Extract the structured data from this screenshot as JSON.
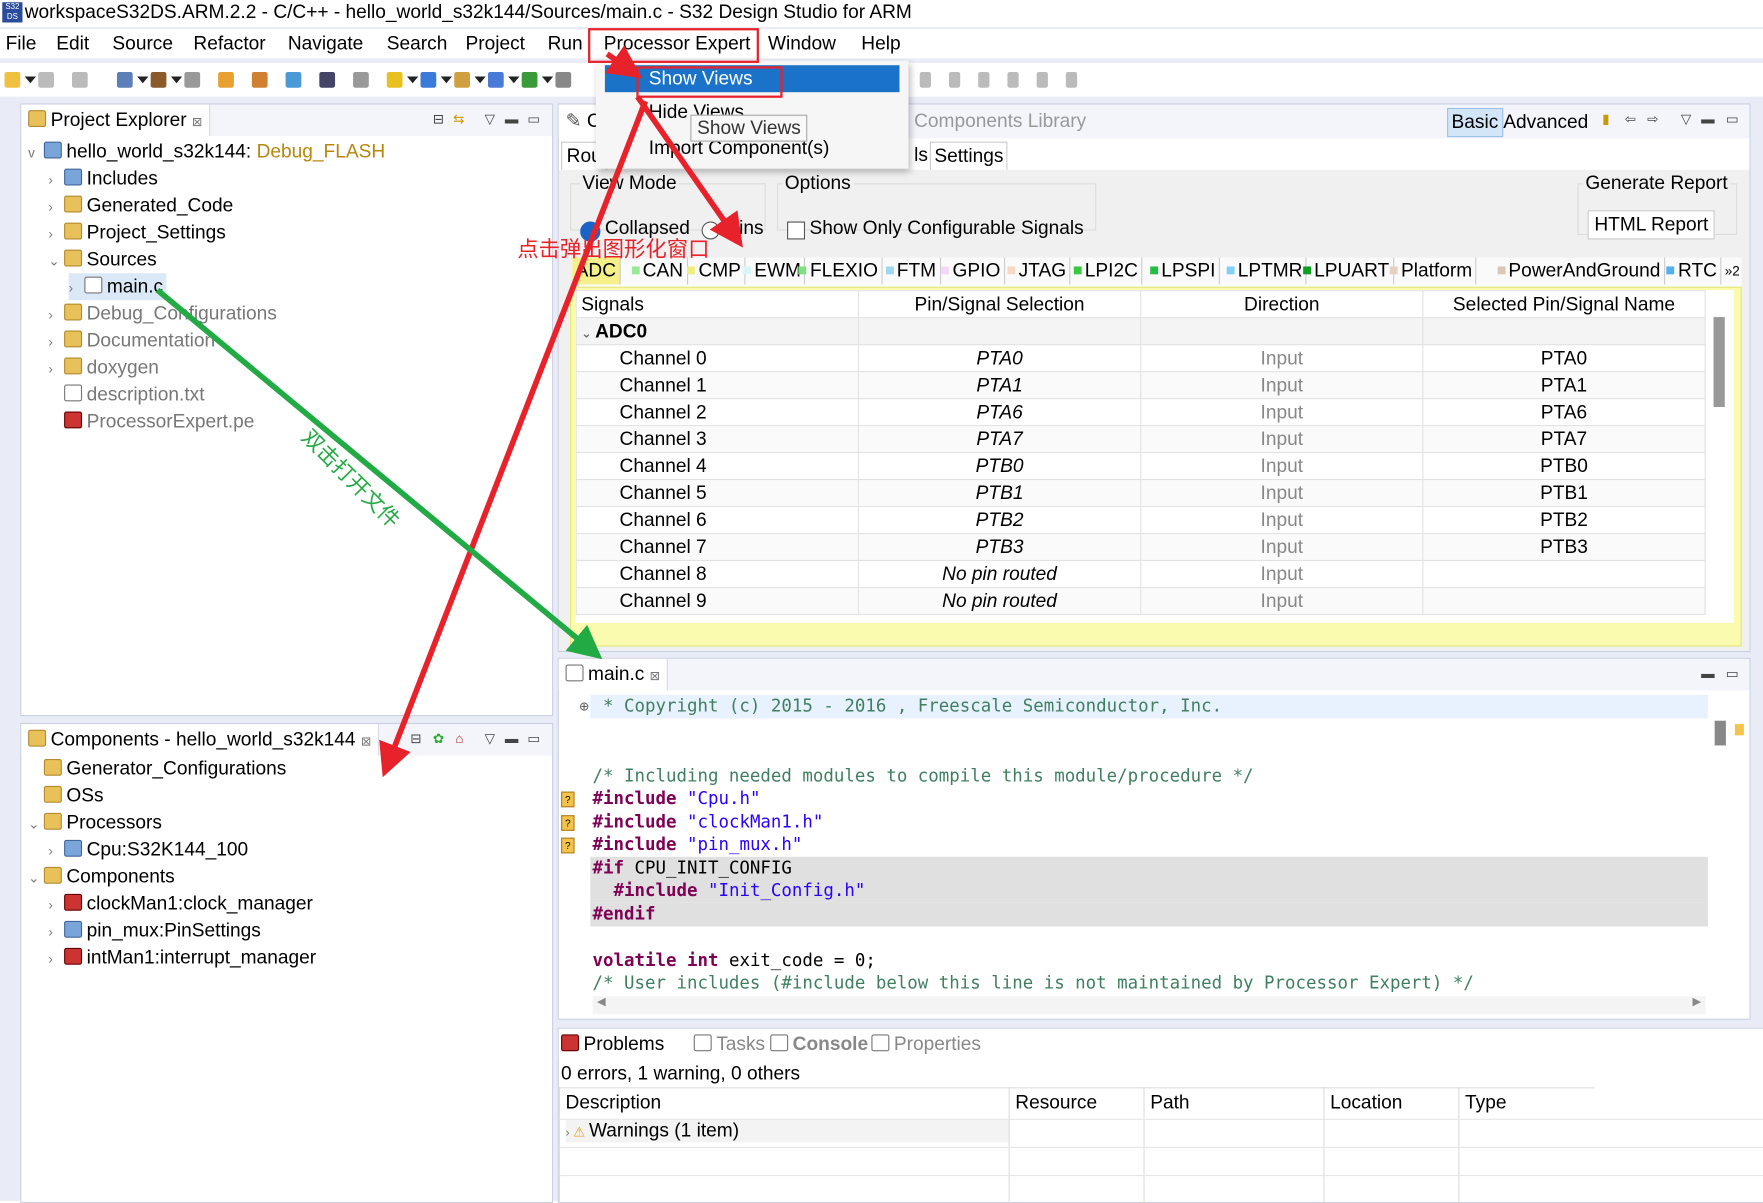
{
  "window": {
    "title": "workspaceS32DS.ARM.2.2 - C/C++ - hello_world_s32k144/Sources/main.c - S32 Design Studio for ARM",
    "logo": "S32 DS"
  },
  "menu": [
    "File",
    "Edit",
    "Source",
    "Refactor",
    "Navigate",
    "Search",
    "Project",
    "Run",
    "Processor Expert",
    "Window",
    "Help"
  ],
  "dropdown": {
    "items": [
      "Show Views",
      "Hide Views",
      "Import Component(s)"
    ],
    "tooltip": "Show Views"
  },
  "project_explorer": {
    "title": "Project Explorer",
    "project": {
      "name": "hello_world_s32k144",
      "config": "Debug_FLASH"
    },
    "items": [
      {
        "label": "Includes",
        "level": 1,
        "icon": "includes",
        "arrow": ">"
      },
      {
        "label": "Generated_Code",
        "level": 1,
        "icon": "folder",
        "arrow": ">"
      },
      {
        "label": "Project_Settings",
        "level": 1,
        "icon": "folder",
        "arrow": ">"
      },
      {
        "label": "Sources",
        "level": 1,
        "icon": "folder",
        "arrow": "v"
      },
      {
        "label": "main.c",
        "level": 2,
        "icon": "file",
        "arrow": ">",
        "selected": true
      },
      {
        "label": "Debug_Configurations",
        "level": 1,
        "icon": "folder",
        "arrow": ">",
        "dim": true
      },
      {
        "label": "Documentation",
        "level": 1,
        "icon": "folder",
        "arrow": ">",
        "dim": true
      },
      {
        "label": "doxygen",
        "level": 1,
        "icon": "folder",
        "arrow": ">",
        "dim": true
      },
      {
        "label": "description.txt",
        "level": 1,
        "icon": "file",
        "arrow": "",
        "dim": true
      },
      {
        "label": "ProcessorExpert.pe",
        "level": 1,
        "icon": "pe",
        "arrow": "",
        "dim": true
      }
    ]
  },
  "components": {
    "title": "Components - hello_world_s32k144",
    "items": [
      {
        "label": "Generator_Configurations",
        "level": 0,
        "icon": "folder",
        "arrow": ""
      },
      {
        "label": "OSs",
        "level": 0,
        "icon": "folder",
        "arrow": ""
      },
      {
        "label": "Processors",
        "level": 0,
        "icon": "folder",
        "arrow": "v"
      },
      {
        "label": "Cpu:S32K144_100",
        "level": 1,
        "icon": "cpu",
        "arrow": ">"
      },
      {
        "label": "Components",
        "level": 0,
        "icon": "folder",
        "arrow": "v"
      },
      {
        "label": "clockMan1:clock_manager",
        "level": 1,
        "icon": "comp",
        "arrow": ">"
      },
      {
        "label": "pin_mux:PinSettings",
        "level": 1,
        "icon": "pin",
        "arrow": ">"
      },
      {
        "label": "intMan1:interrupt_manager",
        "level": 1,
        "icon": "comp",
        "arrow": ">"
      }
    ]
  },
  "pe_view": {
    "tab_partial": "C",
    "library_tab": "Components Library",
    "basic": "Basic",
    "advanced": "Advanced",
    "subtabs": [
      "Rou",
      "ls",
      "Settings"
    ],
    "view_mode": {
      "label": "View Mode",
      "options": [
        "Collapsed",
        "Pins"
      ],
      "selected": "Collapsed"
    },
    "options": {
      "label": "Options",
      "checkbox": "Show Only Configurable Signals",
      "checked": false
    },
    "report": {
      "label": "Generate Report",
      "button": "HTML Report"
    },
    "periph_tabs": [
      {
        "label": "ADC",
        "color": "#f5f08a"
      },
      {
        "label": "CAN",
        "color": "#9be89b"
      },
      {
        "label": "CMP",
        "color": "#f0ee7a"
      },
      {
        "label": "EWM",
        "color": "#d8f6f6"
      },
      {
        "label": "FLEXIO",
        "color": "#7fe07f"
      },
      {
        "label": "FTM",
        "color": "#9ed8f0"
      },
      {
        "label": "GPIO",
        "color": "#f5d8f5"
      },
      {
        "label": "JTAG",
        "color": "#f8d8c0"
      },
      {
        "label": "LPI2C",
        "color": "#3cc83c"
      },
      {
        "label": "LPSPI",
        "color": "#20c040"
      },
      {
        "label": "LPTMR",
        "color": "#80d0f8"
      },
      {
        "label": "LPUART",
        "color": "#10a020"
      },
      {
        "label": "Platform",
        "color": "#e8d0c0"
      },
      {
        "label": "PowerAndGround",
        "color": "#d8c8b8"
      },
      {
        "label": "RTC",
        "color": "#50b0f0"
      }
    ],
    "more_tabs": "»2",
    "columns": [
      "Signals",
      "Pin/Signal Selection",
      "Direction",
      "Selected Pin/Signal Name"
    ],
    "group": "ADC0",
    "rows": [
      [
        "Channel 0",
        "PTA0",
        "Input",
        "PTA0"
      ],
      [
        "Channel 1",
        "PTA1",
        "Input",
        "PTA1"
      ],
      [
        "Channel 2",
        "PTA6",
        "Input",
        "PTA6"
      ],
      [
        "Channel 3",
        "PTA7",
        "Input",
        "PTA7"
      ],
      [
        "Channel 4",
        "PTB0",
        "Input",
        "PTB0"
      ],
      [
        "Channel 5",
        "PTB1",
        "Input",
        "PTB1"
      ],
      [
        "Channel 6",
        "PTB2",
        "Input",
        "PTB2"
      ],
      [
        "Channel 7",
        "PTB3",
        "Input",
        "PTB3"
      ],
      [
        "Channel 8",
        "No pin routed",
        "Input",
        ""
      ],
      [
        "Channel 9",
        "No pin routed",
        "Input",
        ""
      ]
    ]
  },
  "editor": {
    "tab": "main.c",
    "lines": [
      {
        "html": "<span class='cm'> * Copyright (c) 2015 - 2016 , Freescale Semiconductor, Inc.</span>",
        "row": 0,
        "hl": "cur"
      },
      {
        "html": "<span class='cm'>/* Including needed modules to compile this module/procedure */</span>",
        "row": 3
      },
      {
        "html": "<span class='pp'>#include</span> <span class='str'>\"Cpu.h\"</span>",
        "row": 4,
        "warn": true
      },
      {
        "html": "<span class='pp'>#include</span> <span class='str'>\"clockMan1.h\"</span>",
        "row": 5,
        "warn": true
      },
      {
        "html": "<span class='pp'>#include</span> <span class='str'>\"pin_mux.h\"</span>",
        "row": 6,
        "warn": true
      },
      {
        "html": "<span class='pp'>#if</span> CPU_INIT_CONFIG",
        "row": 7,
        "hl": "gray"
      },
      {
        "html": "  <span class='pp'>#include</span> <span class='str'>\"Init_Config.h\"</span>",
        "row": 8,
        "hl": "gray"
      },
      {
        "html": "<span class='pp'>#endif</span>",
        "row": 9,
        "hl": "gray"
      },
      {
        "html": "<span class='kw'>volatile</span> <span class='kw'>int</span> exit_code = 0;",
        "row": 11
      },
      {
        "html": "<span class='cm'>/* User includes (#include below this line is not maintained by Processor Expert) */</span>",
        "row": 12
      }
    ]
  },
  "problems": {
    "tabs": [
      "Problems",
      "Tasks",
      "Console",
      "Properties"
    ],
    "summary": "0 errors, 1 warning, 0 others",
    "columns": [
      "Description",
      "Resource",
      "Path",
      "Location",
      "Type"
    ],
    "warning_row": "Warnings (1 item)"
  },
  "annotations": {
    "red_text": "点击弹出图形化窗口",
    "green_text": "双击打开文件",
    "red": "#e8222a",
    "green": "#22aa44"
  }
}
